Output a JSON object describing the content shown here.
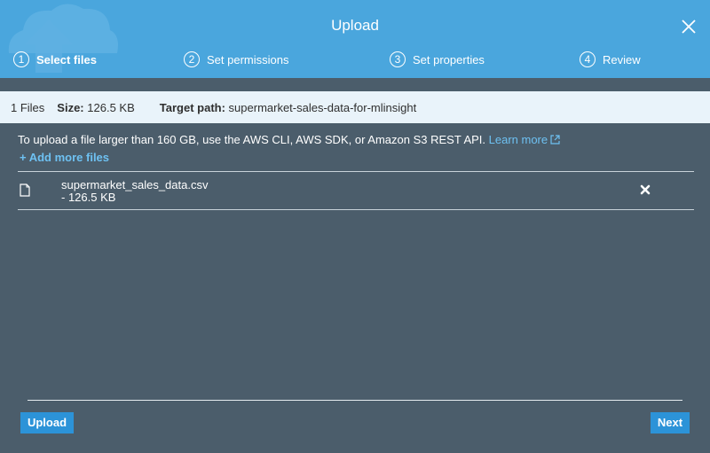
{
  "dialog": {
    "title": "Upload",
    "accent_color": "#4aa6dd",
    "background_color": "#4b5d6b",
    "icons": {
      "close": "close-icon",
      "cloud_upload": "cloud-upload-icon"
    }
  },
  "steps": [
    {
      "number": "1",
      "label": "Select files",
      "active": true
    },
    {
      "number": "2",
      "label": "Set permissions",
      "active": false
    },
    {
      "number": "3",
      "label": "Set properties",
      "active": false
    },
    {
      "number": "4",
      "label": "Review",
      "active": false
    }
  ],
  "summary": {
    "files_count": "1 Files",
    "size_label": "Size:",
    "size_value": "126.5 KB",
    "target_label": "Target path:",
    "target_value": "supermarket-sales-data-for-mlinsight"
  },
  "info": {
    "message": "To upload a file larger than 160 GB, use the AWS CLI, AWS SDK, or Amazon S3 REST API.",
    "learn_more": "Learn more",
    "add_more": "+ Add more files"
  },
  "files": [
    {
      "name": "supermarket_sales_data.csv",
      "size": "- 126.5 KB"
    }
  ],
  "footer": {
    "upload_label": "Upload",
    "next_label": "Next"
  }
}
